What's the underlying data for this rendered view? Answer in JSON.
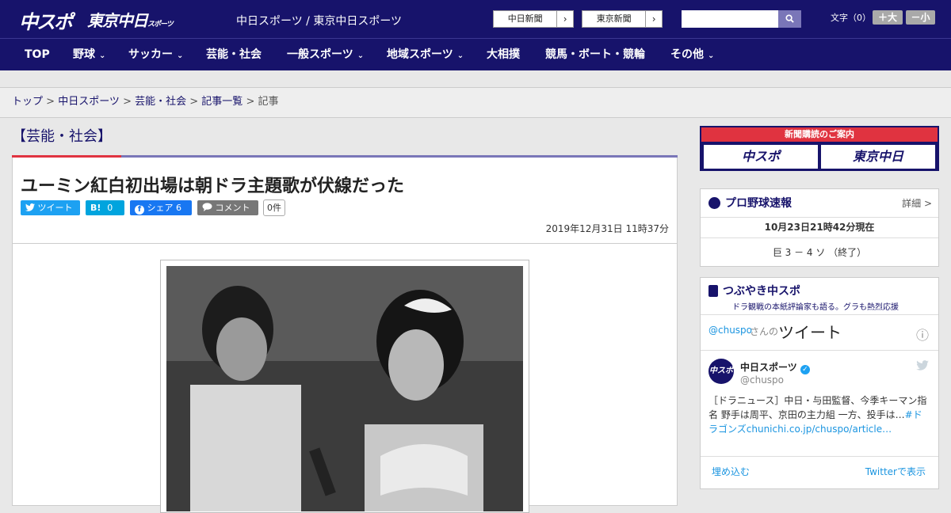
{
  "header": {
    "logo_chuspo": "中スポ",
    "logo_tokyo": "東京中日",
    "logo_tokyo_small": "スポーツ",
    "tagline": "中日スポーツ / 東京中日スポーツ",
    "paper1": "中日新聞",
    "paper2": "東京新聞",
    "arrow": "›",
    "search_icon": "search-icon",
    "font_label": "文字（0）",
    "font_up": "＋大",
    "font_down": "－小"
  },
  "nav": {
    "items": [
      {
        "label": "TOP"
      },
      {
        "label": "野球"
      },
      {
        "label": "サッカー"
      },
      {
        "label": "芸能・社会"
      },
      {
        "label": "一般スポーツ"
      },
      {
        "label": "地域スポーツ"
      },
      {
        "label": "大相撲"
      },
      {
        "label": "競馬・ボート・競輪"
      },
      {
        "label": "その他"
      }
    ],
    "chevron": "⌄"
  },
  "breadcrumb": {
    "items": [
      "トップ",
      "中日スポーツ",
      "芸能・社会",
      "記事一覧"
    ],
    "current": "記事",
    "sep": " > "
  },
  "category": "【芸能・社会】",
  "article": {
    "title": "ユーミン紅白初出場は朝ドラ主題歌が伏線だった",
    "share": {
      "tweet": "ツイート",
      "hatena_label": "B!",
      "hatena_count": "0",
      "facebook_label": "シェア",
      "facebook_count": "6",
      "comment": "コメント",
      "comment_count": "0件"
    },
    "date": "2019年12月31日 11時37分"
  },
  "sidebar": {
    "subscribe_title": "新聞購読のご案内",
    "subscribe_b1": "中スポ",
    "subscribe_b2": "東京中日",
    "score_title": "プロ野球速報",
    "score_more": "詳細 >",
    "score_time": "10月23日21時42分現在",
    "score_line": "巨 3 － 4 ソ （終了）",
    "tsubuyaki_title": "つぶやき中スポ",
    "tsubuyaki_sub": "ドラ観戦の本紙評論家も語る。グラも熱烈応援",
    "tweets_head_handle": "@chuspo",
    "tweets_head_mid": "さんの",
    "tweets_head_label": "ツイート",
    "tweet_name": "中日スポーツ",
    "tweet_handle": "@chuspo",
    "tweet_text": "［ドラニュース］中日・与田監督、今季キーマン指名 野手は周平、京田の主力組 一方、投手は…",
    "tweet_link": "#ドラゴンズchunichi.co.jp/chuspo/article…",
    "embed": "埋め込む",
    "view_on_twitter": "Twitterで表示",
    "info_icon": "ⓘ"
  }
}
